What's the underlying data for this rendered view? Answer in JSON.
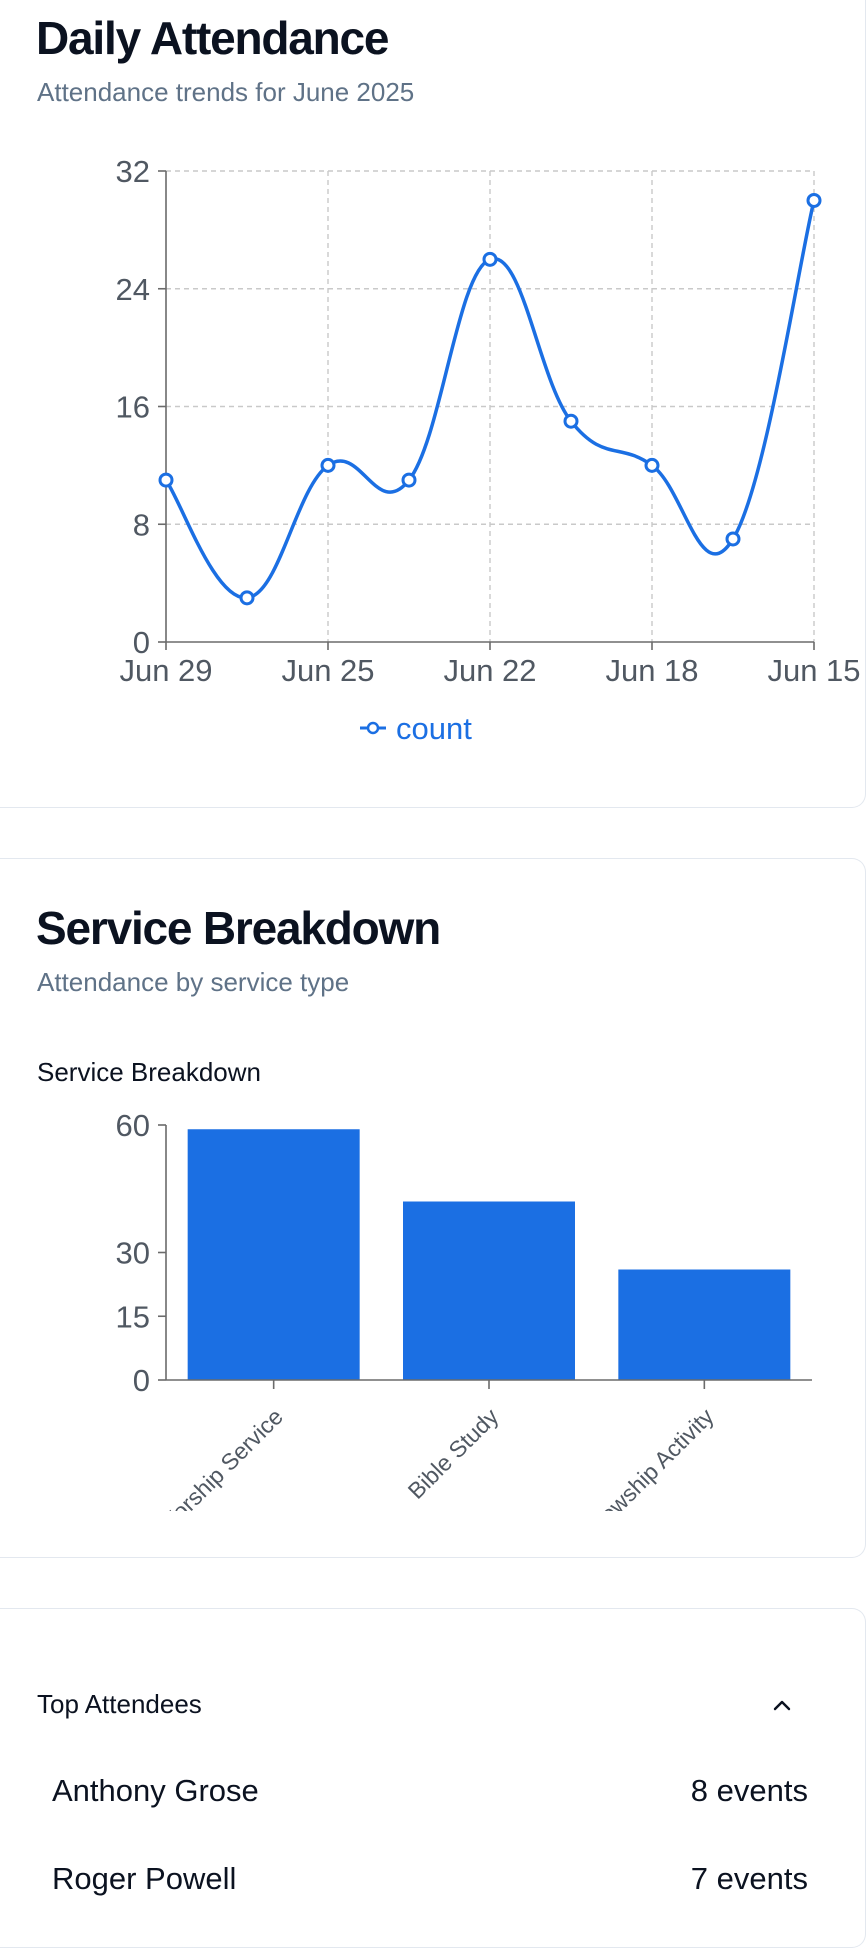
{
  "daily_attendance": {
    "title": "Daily Attendance",
    "subtitle": "Attendance trends for June 2025"
  },
  "service_breakdown": {
    "title": "Service Breakdown",
    "subtitle": "Attendance by service type",
    "chart_label": "Service Breakdown"
  },
  "top_attendees": {
    "title": "Top Attendees",
    "chevron_icon": "chevron-up-icon",
    "rows": [
      {
        "name": "Anthony Grose",
        "count": "8 events"
      },
      {
        "name": "Roger Powell",
        "count": "7 events"
      }
    ]
  },
  "colors": {
    "accent": "#1b6fe3",
    "grid": "#c9c9c9",
    "axis": "#6b6b6b"
  },
  "chart_data": [
    {
      "type": "line",
      "x": [
        "Jun 29",
        "",
        "Jun 25",
        "",
        "Jun 22",
        "",
        "Jun 18",
        "",
        "Jun 15"
      ],
      "x_tick_labels": [
        "Jun 29",
        "Jun 25",
        "Jun 22",
        "Jun 18",
        "Jun 15"
      ],
      "series": [
        {
          "name": "count",
          "values": [
            11,
            3,
            12,
            11,
            26,
            15,
            12,
            7,
            30
          ]
        }
      ],
      "ylim": [
        0,
        32
      ],
      "y_ticks": [
        0,
        8,
        16,
        24,
        32
      ],
      "grid": true,
      "legend": "bottom-center",
      "smooth": true
    },
    {
      "type": "bar",
      "title": "Service Breakdown",
      "categories": [
        "Worship Service",
        "Bible Study",
        "Fellowship Activity"
      ],
      "values": [
        59,
        42,
        26
      ],
      "ylim": [
        0,
        60
      ],
      "y_ticks": [
        0,
        15,
        30,
        60
      ],
      "grid": false,
      "x_label_rotation": -45
    }
  ]
}
